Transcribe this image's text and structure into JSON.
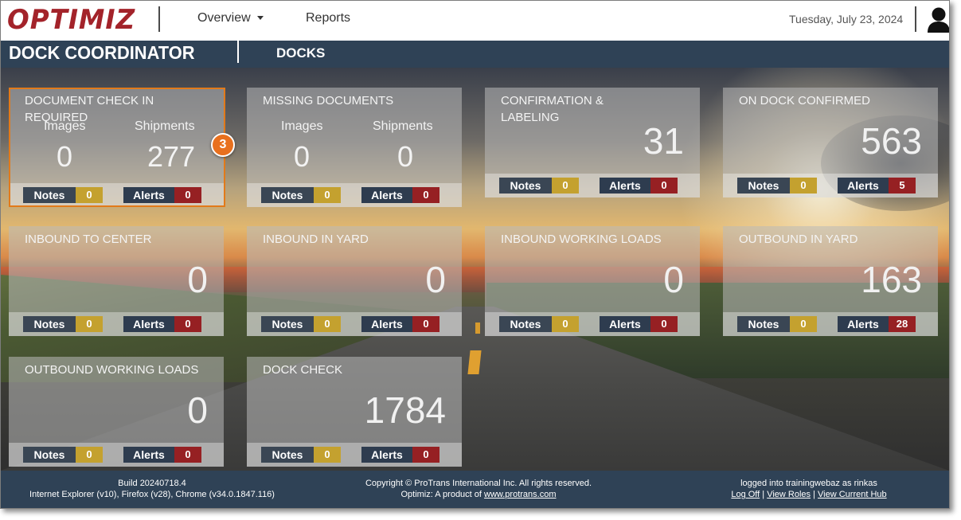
{
  "header": {
    "logo_text": "OPTIMIZ",
    "nav": [
      {
        "label": "Overview",
        "has_dropdown": true
      },
      {
        "label": "Reports",
        "has_dropdown": false
      }
    ],
    "date": "Tuesday, July 23, 2024",
    "user_icon": "user-icon"
  },
  "subheader": {
    "title": "DOCK COORDINATOR",
    "section": "DOCKS"
  },
  "colors": {
    "brand_red": "#a3232a",
    "nav_bar": "#2f4256",
    "notes_count": "#c4a12f",
    "alerts_count": "#962023",
    "highlight": "#e27a1a"
  },
  "tiles": [
    {
      "title": "DOCUMENT CHECK IN REQUIRED",
      "images_label": "Images",
      "images_value": "0",
      "shipments_label": "Shipments",
      "shipments_value": "277",
      "notes_label": "Notes",
      "notes_count": "0",
      "alerts_label": "Alerts",
      "alerts_count": "0"
    },
    {
      "title": "MISSING DOCUMENTS",
      "images_label": "Images",
      "images_value": "0",
      "shipments_label": "Shipments",
      "shipments_value": "0",
      "notes_label": "Notes",
      "notes_count": "0",
      "alerts_label": "Alerts",
      "alerts_count": "0"
    },
    {
      "title": "CONFIRMATION & LABELING",
      "value": "31",
      "notes_label": "Notes",
      "notes_count": "0",
      "alerts_label": "Alerts",
      "alerts_count": "0"
    },
    {
      "title": "ON DOCK CONFIRMED",
      "value": "563",
      "notes_label": "Notes",
      "notes_count": "0",
      "alerts_label": "Alerts",
      "alerts_count": "5"
    },
    {
      "title": "INBOUND TO CENTER",
      "value": "0",
      "notes_label": "Notes",
      "notes_count": "0",
      "alerts_label": "Alerts",
      "alerts_count": "0"
    },
    {
      "title": "INBOUND IN YARD",
      "value": "0",
      "notes_label": "Notes",
      "notes_count": "0",
      "alerts_label": "Alerts",
      "alerts_count": "0"
    },
    {
      "title": "INBOUND WORKING LOADS",
      "value": "0",
      "notes_label": "Notes",
      "notes_count": "0",
      "alerts_label": "Alerts",
      "alerts_count": "0"
    },
    {
      "title": "OUTBOUND IN YARD",
      "value": "163",
      "notes_label": "Notes",
      "notes_count": "0",
      "alerts_label": "Alerts",
      "alerts_count": "28"
    },
    {
      "title": "OUTBOUND WORKING LOADS",
      "value": "0",
      "notes_label": "Notes",
      "notes_count": "0",
      "alerts_label": "Alerts",
      "alerts_count": "0"
    },
    {
      "title": "DOCK CHECK",
      "value": "1784",
      "notes_label": "Notes",
      "notes_count": "0",
      "alerts_label": "Alerts",
      "alerts_count": "0"
    }
  ],
  "callout": {
    "step_number": "3"
  },
  "footer": {
    "build": "Build 20240718.4",
    "browsers": "Internet Explorer (v10), Firefox (v28), Chrome (v34.0.1847.116)",
    "copyright": "Copyright © ProTrans International Inc. All rights reserved.",
    "product_prefix": "Optimiz: A product of",
    "product_link": "www.protrans.com",
    "logged_in": "logged into trainingwebaz as rinkas",
    "links": [
      "Log Off",
      "View Roles",
      "View Current Hub"
    ],
    "separator": "|"
  }
}
